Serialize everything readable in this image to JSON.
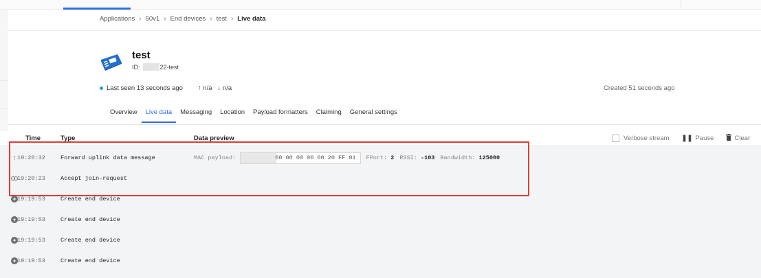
{
  "breadcrumb": {
    "items": [
      "Applications",
      "50v1",
      "End devices",
      "test"
    ],
    "current": "Live data"
  },
  "device": {
    "name": "test",
    "id_label": "ID:",
    "id_suffix": "22-test",
    "icon": "device-icon"
  },
  "status": {
    "last_seen": "Last seen 13 seconds ago",
    "uplink": "↑ n/a",
    "downlink": "↓ n/a",
    "created": "Created 51 seconds ago"
  },
  "tabs": [
    {
      "label": "Overview"
    },
    {
      "label": "Live data",
      "active": true
    },
    {
      "label": "Messaging"
    },
    {
      "label": "Location"
    },
    {
      "label": "Payload formatters"
    },
    {
      "label": "Claiming"
    },
    {
      "label": "General settings"
    }
  ],
  "table": {
    "headers": {
      "time": "Time",
      "type": "Type",
      "preview": "Data preview"
    },
    "controls": {
      "verbose": "Verbose stream",
      "pause": "Pause",
      "clear": "Clear"
    }
  },
  "rows": [
    {
      "icon": "uplink-arrow-icon",
      "time": "19:20:32",
      "type": "Forward uplink data message",
      "preview": {
        "mac_label": "MAC payload:",
        "mac_value": "00 00 00 00 00 20 FF 01",
        "fport_label": "FPort:",
        "fport": "2",
        "rssi_label": "RSSI:",
        "rssi": "-103",
        "bw_label": "Bandwidth:",
        "bw": "125000"
      }
    },
    {
      "icon": "link-icon",
      "time": "19:20:23",
      "type": "Accept join-request"
    },
    {
      "icon": "plus-circle-icon",
      "time": "19:19:53",
      "type": "Create end device"
    },
    {
      "icon": "plus-circle-icon",
      "time": "19:19:53",
      "type": "Create end device"
    },
    {
      "icon": "plus-circle-icon",
      "time": "19:19:53",
      "type": "Create end device"
    },
    {
      "icon": "plus-circle-icon",
      "time": "19:19:53",
      "type": "Create end device"
    }
  ],
  "colors": {
    "accent": "#2b6de4",
    "highlight": "#e53935",
    "status_dot": "#2b9bd8"
  }
}
